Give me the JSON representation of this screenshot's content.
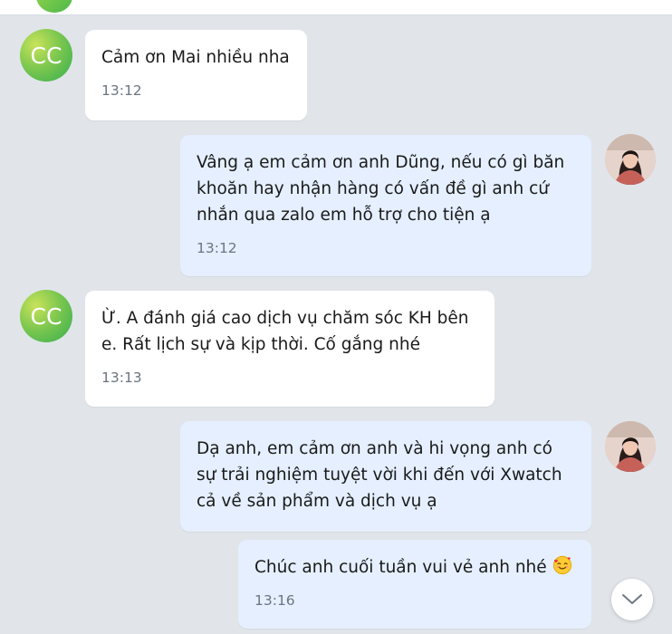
{
  "contact": {
    "avatar_initials": "CC"
  },
  "messages": [
    {
      "direction": "in",
      "text": "Cảm ơn Mai nhiều nha",
      "time": "13:12"
    },
    {
      "direction": "out",
      "text": "Vâng ạ em cảm ơn anh Dũng, nếu có gì băn khoăn hay nhận hàng có vấn đề gì anh cứ nhắn qua zalo em hỗ trợ cho tiện ạ",
      "time": "13:12"
    },
    {
      "direction": "in",
      "text": "Ừ. A đánh giá cao dịch vụ chăm sóc KH bên e. Rất lịch sự và kịp thời. Cố gắng nhé",
      "time": "13:13"
    },
    {
      "direction": "out",
      "text": "Dạ anh, em cảm ơn anh và hi vọng anh có sự trải nghiệm tuyệt vời khi đến với Xwatch cả về sản phẩm và dịch vụ ạ",
      "time": ""
    },
    {
      "direction": "out",
      "text": "Chúc anh cuối tuần vui vẻ anh nhé",
      "time": "13:16",
      "emoji": "smiling-face-with-hearts"
    }
  ],
  "icons": {
    "scroll_down": "chevron-down-icon"
  },
  "colors": {
    "background": "#e1e5ea",
    "incoming_bubble": "#ffffff",
    "outgoing_bubble": "#e5efff",
    "avatar_gradient_start": "#c9e35a",
    "avatar_gradient_end": "#34ad4f",
    "timestamp": "#6b7580"
  }
}
